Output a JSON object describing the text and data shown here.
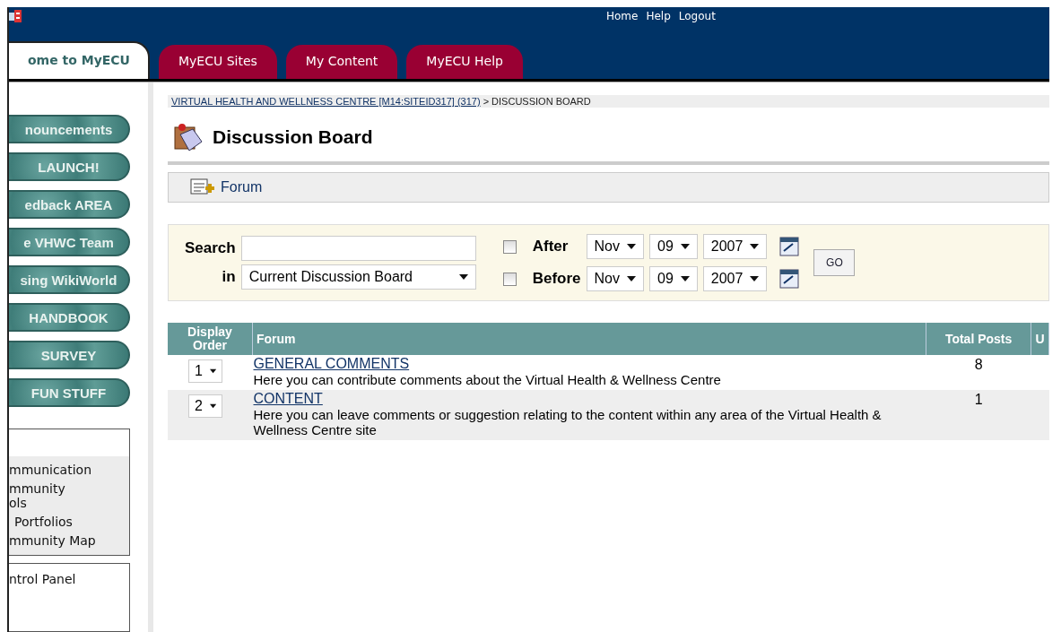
{
  "header": {
    "links": [
      "Home",
      "Help",
      "Logout"
    ]
  },
  "tabs": [
    {
      "label": "ome to MyECU",
      "selected": true
    },
    {
      "label": "MyECU Sites",
      "selected": false
    },
    {
      "label": "My Content",
      "selected": false
    },
    {
      "label": "MyECU Help",
      "selected": false
    }
  ],
  "sidebar": {
    "buttons": [
      "nouncements",
      "LAUNCH!",
      "edback AREA",
      "e VHWC Team",
      "sing WikiWorld",
      "HANDBOOK",
      "SURVEY",
      "FUN STUFF"
    ],
    "tools": [
      "mmunication",
      "mmunity\nols",
      "Portfolios",
      "mmunity Map"
    ],
    "panel": [
      "ntrol Panel"
    ]
  },
  "breadcrumb": {
    "link": "VIRTUAL HEALTH AND WELLNESS CENTRE [M14:SITEID317] (317)",
    "current": "> DISCUSSION BOARD"
  },
  "title": "Discussion Board",
  "action_bar": {
    "label": "Forum"
  },
  "search": {
    "label": "Search",
    "in_label": "in",
    "scope": "Current Discussion Board",
    "after": {
      "label": "After",
      "checked": false,
      "month": "Nov",
      "day": "09",
      "year": "2007"
    },
    "before": {
      "label": "Before",
      "checked": false,
      "month": "Nov",
      "day": "09",
      "year": "2007"
    },
    "go": "GO"
  },
  "table": {
    "columns": [
      "Display Order",
      "Forum",
      "Total Posts",
      "U"
    ],
    "rows": [
      {
        "order": "1",
        "title": "GENERAL COMMENTS",
        "description": "Here you can contribute comments about the Virtual Health & Wellness Centre",
        "total_posts": "8"
      },
      {
        "order": "2",
        "title": "CONTENT",
        "description": "Here you can leave comments or suggestion relating to the content within any area of the Virtual Health & Wellness Centre site",
        "total_posts": "1"
      }
    ]
  }
}
